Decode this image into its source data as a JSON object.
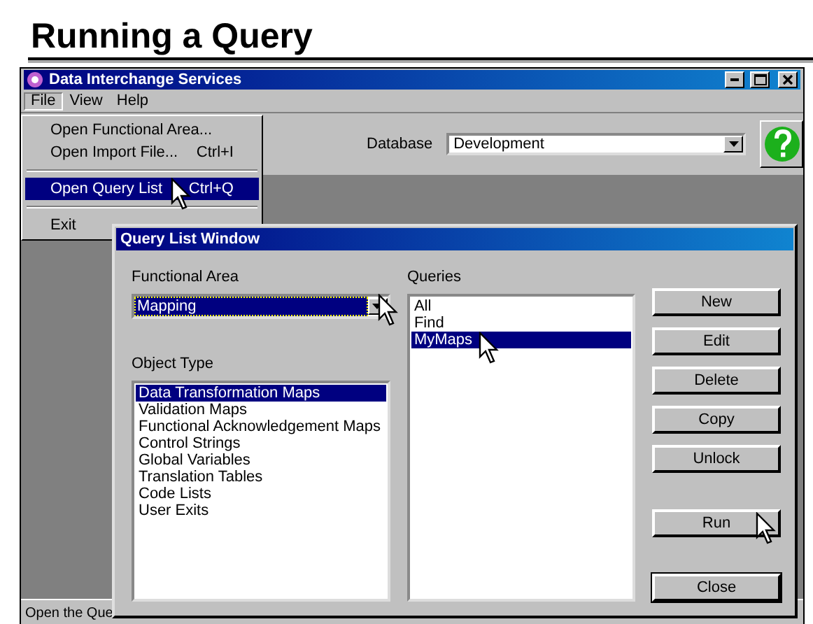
{
  "slide_title": "Running a Query",
  "window": {
    "title": "Data Interchange Services"
  },
  "menu_bar": [
    {
      "label": "File",
      "selected": true
    },
    {
      "label": "View",
      "selected": false
    },
    {
      "label": "Help",
      "selected": false
    }
  ],
  "file_menu": [
    {
      "kind": "item",
      "label": "Open Functional Area...",
      "selected": false
    },
    {
      "kind": "item",
      "label": "Open Import File...",
      "shortcut": "Ctrl+I",
      "selected": false
    },
    {
      "kind": "separator"
    },
    {
      "kind": "item",
      "label": "Open Query List",
      "shortcut": "Ctrl+Q",
      "selected": true
    },
    {
      "kind": "separator"
    },
    {
      "kind": "item",
      "label": "Exit",
      "selected": false
    }
  ],
  "toolbar": {
    "database_label": "Database",
    "database_value": "Development"
  },
  "status_bar": "Open the Que",
  "dialog": {
    "title": "Query List Window",
    "functional_area_label": "Functional Area",
    "functional_area_value": "Mapping",
    "object_type_label": "Object Type",
    "object_types": [
      {
        "label": "Data Transformation Maps",
        "selected": true
      },
      {
        "label": "Validation Maps",
        "selected": false
      },
      {
        "label": "Functional Acknowledgement Maps",
        "selected": false
      },
      {
        "label": "Control Strings",
        "selected": false
      },
      {
        "label": "Global Variables",
        "selected": false
      },
      {
        "label": "Translation Tables",
        "selected": false
      },
      {
        "label": "Code Lists",
        "selected": false
      },
      {
        "label": "User Exits",
        "selected": false
      }
    ],
    "queries_label": "Queries",
    "queries": [
      {
        "label": "All",
        "selected": false
      },
      {
        "label": "Find",
        "selected": false
      },
      {
        "label": "MyMaps",
        "selected": true
      }
    ],
    "button_groups": [
      {
        "buttons": [
          {
            "label": "New",
            "default": false
          },
          {
            "label": "Edit",
            "default": false
          },
          {
            "label": "Delete",
            "default": false
          },
          {
            "label": "Copy",
            "default": false
          },
          {
            "label": "Unlock",
            "default": false
          }
        ]
      },
      {
        "buttons": [
          {
            "label": "Run",
            "default": false
          }
        ]
      },
      {
        "buttons": [
          {
            "label": "Close",
            "default": true
          }
        ]
      }
    ]
  }
}
